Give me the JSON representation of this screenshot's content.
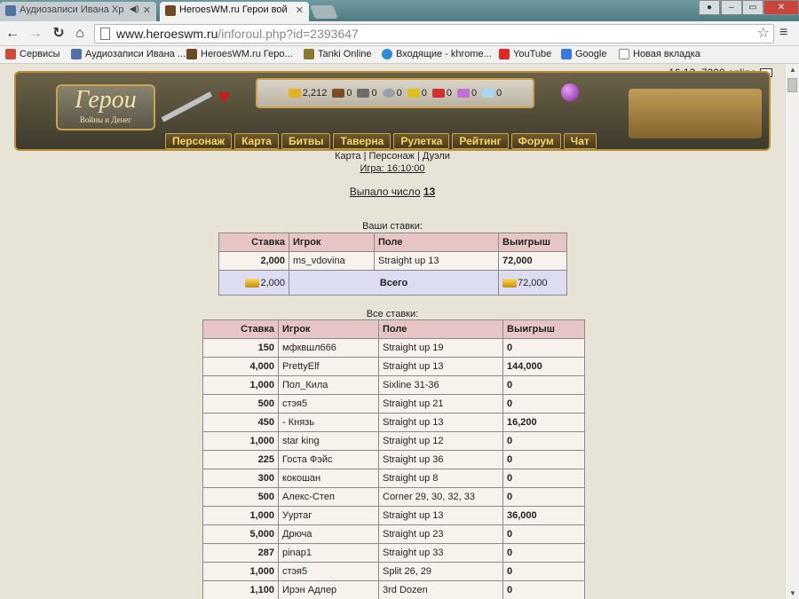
{
  "browser": {
    "tabs": [
      {
        "title": "Аудиозаписи Ивана Хр",
        "active": false
      },
      {
        "title": "HeroesWM.ru Герои вой",
        "active": true
      }
    ],
    "url_host": "www.heroeswm.ru",
    "url_path": "/inforoul.php?id=2393647",
    "bookmarks": [
      {
        "label": "Сервисы"
      },
      {
        "label": "Аудиозаписи Ивана ..."
      },
      {
        "label": "HeroesWM.ru Геро..."
      },
      {
        "label": "Tanki Online"
      },
      {
        "label": "Входящие - khrome..."
      },
      {
        "label": "YouTube"
      },
      {
        "label": "Google"
      },
      {
        "label": "Новая вкладка"
      }
    ]
  },
  "header": {
    "status": "16:13, 7209 online",
    "logo_title": "Герои",
    "logo_subtitle": "Войны и Денег",
    "resources": [
      "2,212",
      "0",
      "0",
      "0",
      "0",
      "0",
      "0",
      "0"
    ],
    "nav": [
      "Персонаж",
      "Карта",
      "Битвы",
      "Таверна",
      "Рулетка",
      "Рейтинг",
      "Форум",
      "Чат"
    ]
  },
  "sublinks": {
    "map": "Карта",
    "character": "Персонаж",
    "duels": "Дуэли",
    "sep": "|",
    "game": "Игра: 16:10:00"
  },
  "result": {
    "label": "Выпало число",
    "number": "13"
  },
  "my_bets": {
    "caption": "Ваши ставки:",
    "headers": [
      "Ставка",
      "Игрок",
      "Поле",
      "Выигрыш"
    ],
    "rows": [
      [
        "2,000",
        "ms_vdovina",
        "Straight up 13",
        "72,000"
      ]
    ],
    "total_label": "Всего",
    "total_bet": "2,000",
    "total_win": "72,000"
  },
  "all_bets": {
    "caption": "Все ставки:",
    "headers": [
      "Ставка",
      "Игрок",
      "Поле",
      "Выигрыш"
    ],
    "rows": [
      [
        "150",
        "мфквшл666",
        "Straight up 19",
        "0"
      ],
      [
        "4,000",
        "PrettyElf",
        "Straight up 13",
        "144,000"
      ],
      [
        "1,000",
        "Пол_Кила",
        "Sixline 31-36",
        "0"
      ],
      [
        "500",
        "стэя5",
        "Straight up 21",
        "0"
      ],
      [
        "450",
        "- Князь",
        "Straight up 13",
        "16,200"
      ],
      [
        "1,000",
        "star king",
        "Straight up 12",
        "0"
      ],
      [
        "225",
        "Госта Фэйс",
        "Straight up 36",
        "0"
      ],
      [
        "300",
        "кокошан",
        "Straight up 8",
        "0"
      ],
      [
        "500",
        "Алекс-Степ",
        "Corner 29, 30, 32, 33",
        "0"
      ],
      [
        "1,000",
        "Ууртаг",
        "Straight up 13",
        "36,000"
      ],
      [
        "5,000",
        "Дрюча",
        "Straight up 23",
        "0"
      ],
      [
        "287",
        "pinap1",
        "Straight up 33",
        "0"
      ],
      [
        "1,000",
        "стэя5",
        "Split 26, 29",
        "0"
      ],
      [
        "1,100",
        "Ирэн Адлер",
        "3rd Dozen",
        "0"
      ]
    ]
  },
  "colors": {
    "header_row": "#e8c5c5",
    "total_row": "#dcdcf3",
    "nav_text": "#f5d36a"
  }
}
